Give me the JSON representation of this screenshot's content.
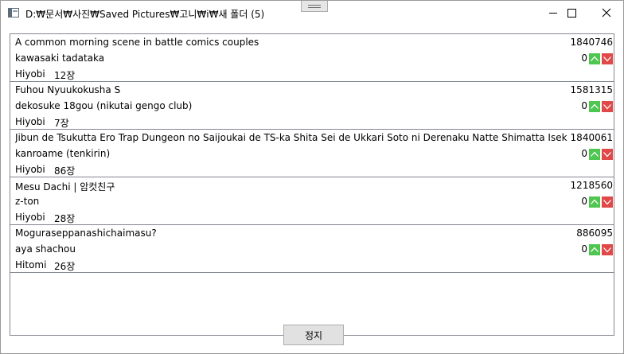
{
  "window": {
    "title": "D:₩문서₩사진₩Saved Pictures₩고니₩i₩새 폴더 (5)"
  },
  "items": [
    {
      "title": "A common morning scene in battle comics couples",
      "count": "1840746",
      "artist": "kawasaki tadataka",
      "score": "0",
      "source": "Hiyobi",
      "pages": "12장"
    },
    {
      "title": "Fuhou Nyuukokusha S",
      "count": "1581315",
      "artist": "dekosuke 18gou (nikutai gengo club)",
      "score": "0",
      "source": "Hiyobi",
      "pages": "7장"
    },
    {
      "title": "Jibun de Tsukutta Ero Trap Dungeon no Saijoukai de TS-ka Shita Sei de Ukkari Soto ni Derenaku Natte Shimatta Isekai Tensei Yuusha",
      "count": "1840061",
      "artist": "kanroame (tenkirin)",
      "score": "0",
      "source": "Hiyobi",
      "pages": "86장"
    },
    {
      "title": "Mesu Dachi | 암컷친구",
      "count": "1218560",
      "artist": "z-ton",
      "score": "0",
      "source": "Hiyobi",
      "pages": "28장"
    },
    {
      "title": "Moguraseppanashichaimasu?",
      "count": "886095",
      "artist": "aya shachou",
      "score": "0",
      "source": "Hitomi",
      "pages": "26장"
    }
  ],
  "footer": {
    "stop_label": "정지"
  },
  "colors": {
    "upvote": "#4fc64f",
    "downvote": "#e14848",
    "border": "#828790",
    "button_bg": "#e1e1e1"
  },
  "icons": {
    "app": "window-app-icon",
    "minimize": "minimize-icon",
    "maximize": "maximize-icon",
    "close": "close-icon",
    "upvote": "chevron-up-icon",
    "downvote": "chevron-down-icon"
  }
}
